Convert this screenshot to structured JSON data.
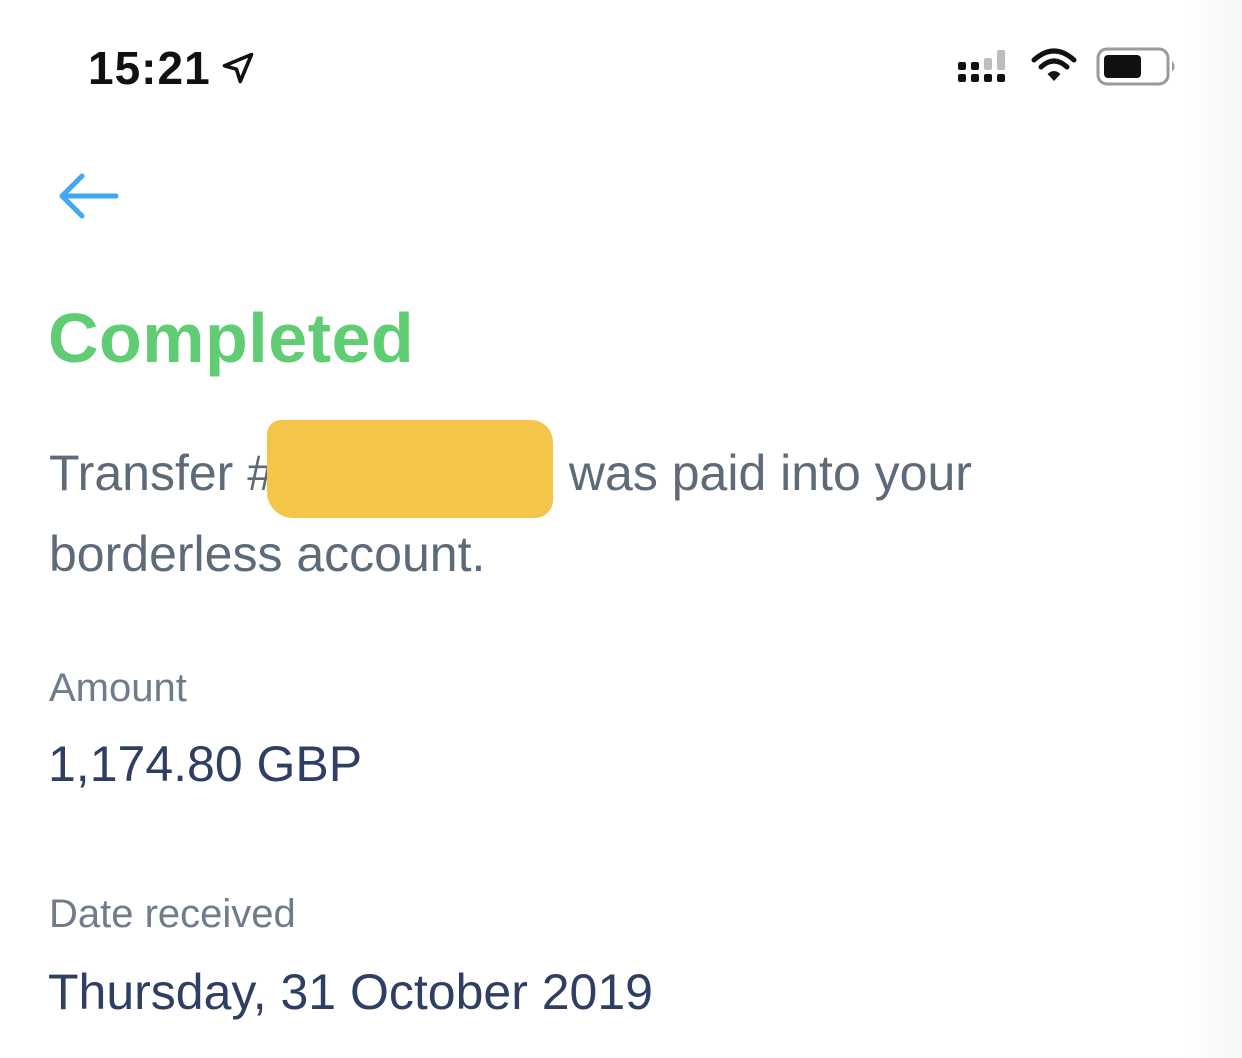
{
  "status_bar": {
    "time": "15:21",
    "location_icon": "location-arrow-icon",
    "signal_icon": "cellular-signal-icon",
    "wifi_icon": "wifi-icon",
    "battery_icon": "battery-icon"
  },
  "nav": {
    "back_icon": "arrow-left-icon"
  },
  "transfer": {
    "status": "Completed",
    "message_prefix": "Transfer #",
    "message_suffix": " was paid into your borderless account."
  },
  "details": {
    "amount_label": "Amount",
    "amount_value": "1,174.80 GBP",
    "date_label": "Date received",
    "date_value": "Thursday, 31 October 2019"
  },
  "colors": {
    "status_green": "#60cc74",
    "accent_blue": "#3fa9f5",
    "body_text": "#5d6b79",
    "value_text": "#2f3f63",
    "redaction_yellow": "#f3c548"
  }
}
